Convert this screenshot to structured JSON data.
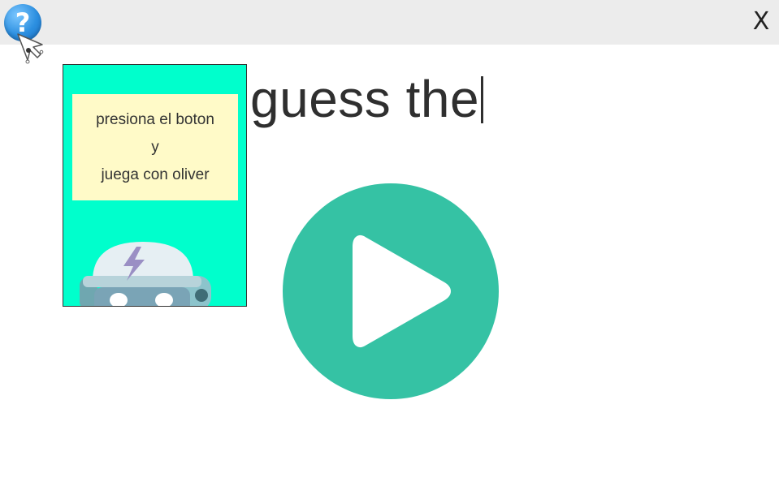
{
  "window": {
    "help_label": "?",
    "close_label": "X"
  },
  "card": {
    "line1": "presiona el boton",
    "line2": "y",
    "line3": "juega con oliver"
  },
  "title": "guess the",
  "icons": {
    "help": "question-icon",
    "cursor": "pointer-cursor-icon",
    "robot": "robot-icon",
    "play": "play-icon"
  },
  "colors": {
    "card_background": "#00ffcc",
    "note_background": "#fffac8",
    "play_button": "#35c2a4",
    "help_button": "#2c8fe0"
  }
}
